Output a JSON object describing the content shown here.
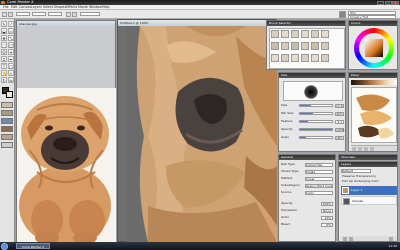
{
  "window": {
    "title": "Corel Painter X"
  },
  "menu": [
    "File",
    "Edit",
    "Canvas",
    "Layers",
    "Select",
    "Shapes",
    "Effects",
    "Movie",
    "Window",
    "Help"
  ],
  "documents": {
    "reference_title": "shar-pei.jpg",
    "canvas_title": "Untitled-1 @ 100%"
  },
  "brush_selector": {
    "title": "Brush Selector",
    "category": "Oils",
    "variant": "Smeary Flat"
  },
  "colors": {
    "title": "Colors"
  },
  "mixer": {
    "title": "Mixer"
  },
  "general_palette": {
    "title": "Size",
    "rows": [
      "Size",
      "Min Size",
      "Feature",
      "Opacity",
      "Grain"
    ]
  },
  "general_values": [
    "12.6",
    "40%",
    "3.1",
    "100%",
    "18%"
  ],
  "general_levels": [
    0.35,
    0.4,
    0.25,
    1.0,
    0.18
  ],
  "general2_palette": {
    "title": "General",
    "rows": [
      "Dab Type",
      "Stroke Type",
      "Method",
      "Subcategory",
      "Source",
      "Opacity",
      "Expression",
      "Grain",
      "Bleed"
    ],
    "values": [
      "Camel Hair",
      "Single",
      "Cover",
      "Grainy Hard Cover",
      "Color",
      "100%",
      "None",
      "12%",
      "5%"
    ]
  },
  "channels": {
    "title": "Channels"
  },
  "layers": {
    "title": "Layers",
    "mode": "Default",
    "preserve": "Preserve Transparency",
    "pick": "Pick Up Underlying Color",
    "items": [
      "Layer 1",
      "Canvas"
    ]
  },
  "taskbar": {
    "item": "Corel Painter X",
    "clock": "11:42"
  },
  "chart_hint_none": "",
  "accent": "#5a7fb8"
}
